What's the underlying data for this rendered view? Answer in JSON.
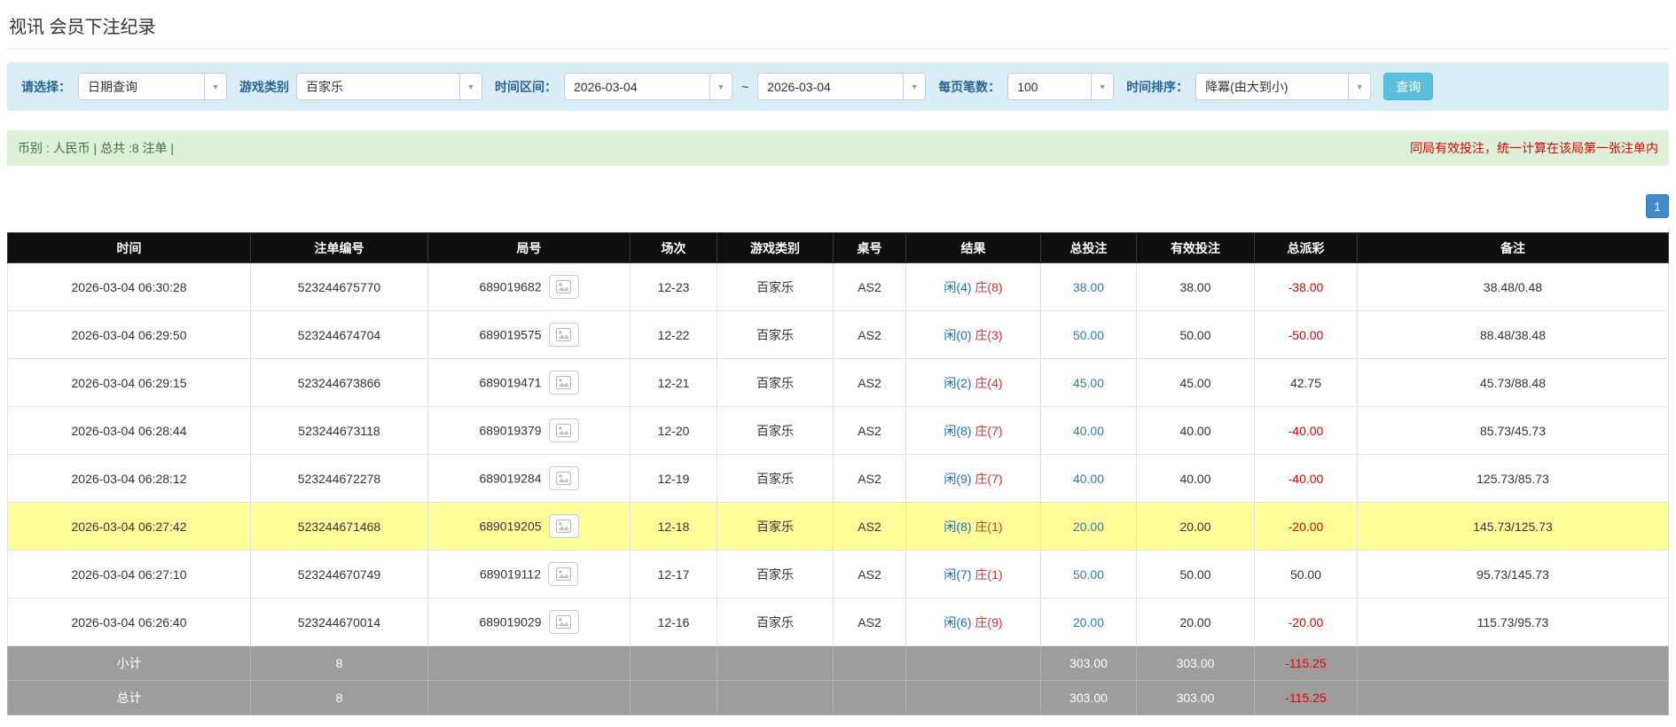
{
  "page": {
    "title": "视讯 会员下注纪录"
  },
  "icons": {
    "dropdown_caret": "▼"
  },
  "filter_bar": {
    "select_label": "请选择：",
    "select_value": "日期查询",
    "game_type_label": "游戏类别",
    "game_type_value": "百家乐",
    "time_range_label": "时间区间：",
    "date_from": "2026-03-04",
    "range_separator": "~",
    "date_to": "2026-03-04",
    "page_size_label": "每页笔数：",
    "page_size_value": "100",
    "sort_label": "时间排序：",
    "sort_value": "降冪(由大到小)",
    "search_button_label": "查询"
  },
  "summary_bar": {
    "left_text": "币别 : 人民币 | 总共 :8 注单 |",
    "right_notice": "同局有效投注，统一计算在该局第一张注单内"
  },
  "pagination": {
    "current_page": "1"
  },
  "colors": {
    "accent_blue": "#428bca",
    "search_button": "#5bc0de",
    "filter_bg": "#d9edf7",
    "summary_bg": "#dff0d8",
    "highlight_row": "#ffff99",
    "negative_red": "#e60000",
    "link_blue": "#337ab7",
    "player_blue": "#1b6ac9",
    "banker_red": "#d9302c"
  },
  "table": {
    "headers": [
      "时间",
      "注单编号",
      "局号",
      "场次",
      "游戏类别",
      "桌号",
      "结果",
      "总投注",
      "有效投注",
      "总派彩",
      "备注"
    ],
    "rows": [
      {
        "time": "2026-03-04 06:30:28",
        "bet_id": "523244675770",
        "round": "689019682",
        "session": "12-23",
        "game": "百家乐",
        "table_no": "AS2",
        "result_player": "闲(4)",
        "result_banker": "庄(8)",
        "total_bet": "38.00",
        "valid_bet": "38.00",
        "payout": "-38.00",
        "note": "38.48/0.48",
        "highlight": false
      },
      {
        "time": "2026-03-04 06:29:50",
        "bet_id": "523244674704",
        "round": "689019575",
        "session": "12-22",
        "game": "百家乐",
        "table_no": "AS2",
        "result_player": "闲(0)",
        "result_banker": "庄(3)",
        "total_bet": "50.00",
        "valid_bet": "50.00",
        "payout": "-50.00",
        "note": "88.48/38.48",
        "highlight": false
      },
      {
        "time": "2026-03-04 06:29:15",
        "bet_id": "523244673866",
        "round": "689019471",
        "session": "12-21",
        "game": "百家乐",
        "table_no": "AS2",
        "result_player": "闲(2)",
        "result_banker": "庄(4)",
        "total_bet": "45.00",
        "valid_bet": "45.00",
        "payout": "42.75",
        "note": "45.73/88.48",
        "highlight": false
      },
      {
        "time": "2026-03-04 06:28:44",
        "bet_id": "523244673118",
        "round": "689019379",
        "session": "12-20",
        "game": "百家乐",
        "table_no": "AS2",
        "result_player": "闲(8)",
        "result_banker": "庄(7)",
        "total_bet": "40.00",
        "valid_bet": "40.00",
        "payout": "-40.00",
        "note": "85.73/45.73",
        "highlight": false
      },
      {
        "time": "2026-03-04 06:28:12",
        "bet_id": "523244672278",
        "round": "689019284",
        "session": "12-19",
        "game": "百家乐",
        "table_no": "AS2",
        "result_player": "闲(9)",
        "result_banker": "庄(7)",
        "total_bet": "40.00",
        "valid_bet": "40.00",
        "payout": "-40.00",
        "note": "125.73/85.73",
        "highlight": false
      },
      {
        "time": "2026-03-04 06:27:42",
        "bet_id": "523244671468",
        "round": "689019205",
        "session": "12-18",
        "game": "百家乐",
        "table_no": "AS2",
        "result_player": "闲(8)",
        "result_banker": "庄(1)",
        "total_bet": "20.00",
        "valid_bet": "20.00",
        "payout": "-20.00",
        "note": "145.73/125.73",
        "highlight": true
      },
      {
        "time": "2026-03-04 06:27:10",
        "bet_id": "523244670749",
        "round": "689019112",
        "session": "12-17",
        "game": "百家乐",
        "table_no": "AS2",
        "result_player": "闲(7)",
        "result_banker": "庄(1)",
        "total_bet": "50.00",
        "valid_bet": "50.00",
        "payout": "50.00",
        "note": "95.73/145.73",
        "highlight": false
      },
      {
        "time": "2026-03-04 06:26:40",
        "bet_id": "523244670014",
        "round": "689019029",
        "session": "12-16",
        "game": "百家乐",
        "table_no": "AS2",
        "result_player": "闲(6)",
        "result_banker": "庄(9)",
        "total_bet": "20.00",
        "valid_bet": "20.00",
        "payout": "-20.00",
        "note": "115.73/95.73",
        "highlight": false
      }
    ],
    "subtotal": {
      "label": "小计",
      "count": "8",
      "total_bet": "303.00",
      "valid_bet": "303.00",
      "payout": "-115.25"
    },
    "total": {
      "label": "总计",
      "count": "8",
      "total_bet": "303.00",
      "valid_bet": "303.00",
      "payout": "-115.25"
    }
  }
}
